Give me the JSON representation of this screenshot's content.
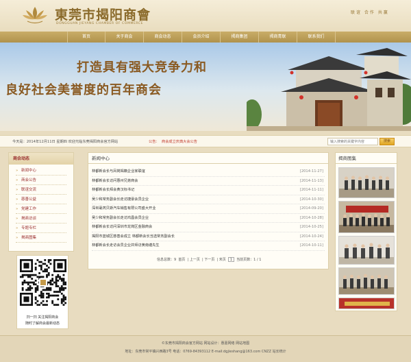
{
  "header": {
    "brand_cn": "東莞市揭阳商會",
    "brand_en": "DONGGUAN JIEYANG CHAMBER OF COMMERCE",
    "slogan": "联谊 合作 共赢"
  },
  "nav": {
    "items": [
      "首页",
      "关于商会",
      "商会动态",
      "会员介绍",
      "揭商集团",
      "揭商青联",
      "联系我们"
    ]
  },
  "banner": {
    "line1": "打造具有强大竞争力和",
    "line2": "良好社会美誉度的百年商会"
  },
  "infobar": {
    "date_text": "今天是：2014年12月11日 星期四 欢迎光临东莞揭阳商会官方网站",
    "notice_label": "公告：",
    "notice_text": "商会成立庆典大会公告",
    "search_placeholder": "输入搜索的关键字内容",
    "search_button": "搜索"
  },
  "sidebar": {
    "title": "商会动态",
    "items": [
      "新闻中心",
      "商会公告",
      "联谊交流",
      "慈善公益",
      "党建工作",
      "揭商访谈",
      "专题专栏",
      "揭商图集"
    ]
  },
  "qr": {
    "caption1": "扫一扫 关注揭阳商会",
    "caption2": "随时了解商会最新动态"
  },
  "news": {
    "title": "新闻中心",
    "items": [
      {
        "title": "林都新会长与凤岗揭籍企业家联谊",
        "date": "[2014-11-27]"
      },
      {
        "title": "林都新会长访问惠州兄弟商会",
        "date": "[2014-11-13]"
      },
      {
        "title": "林都新会长拜会黄汉标书记",
        "date": "[2014-11-11]"
      },
      {
        "title": "吴少和常务副会长走访捷豪会员企业",
        "date": "[2014-10-30]"
      },
      {
        "title": "深圳毫芮贝斯汽车销售有限公司盛大开业",
        "date": "[2014-09-20]"
      },
      {
        "title": "吴少和常务副会长走访鸿昌会员企业",
        "date": "[2014-10-28]"
      },
      {
        "title": "林都新会长访问深圳市龙岗区金融商会",
        "date": "[2014-10-25]"
      },
      {
        "title": "揭阳市蓝城区慈善会成立 林都新会长当选常务副会长",
        "date": "[2014-10-24]"
      },
      {
        "title": "林都新会长走访会员企业并拜访黄南塘先生",
        "date": "[2014-10-11]"
      }
    ],
    "pager": {
      "total": "信息总数：9",
      "first": "首页",
      "prev": "上一页",
      "next": "下一页",
      "last": "末页",
      "page": "1",
      "of": "当前页数：1 / 1"
    }
  },
  "photos": {
    "title": "揭商图集"
  },
  "footer": {
    "line1": "©东莞市揭阳商会官方网站  网站设计：惠嘉网络 网站地图",
    "line2": "地址：东莞市常平镇兴西路3号  电话：0769-84393112  E-mail:dgjieshang@163.com  CNZZ 站长统计"
  },
  "colors": {
    "gold": "#b0924c",
    "brown_text": "#8a5a22",
    "red_text": "#9a2e2e"
  }
}
